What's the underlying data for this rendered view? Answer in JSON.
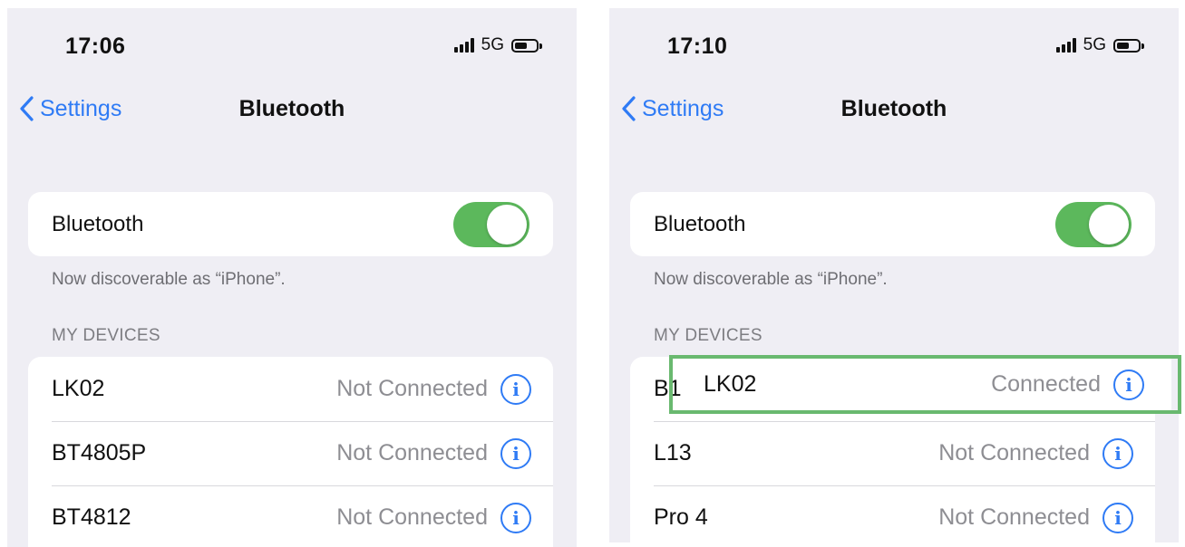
{
  "left": {
    "status": {
      "time": "17:06",
      "network": "5G"
    },
    "nav": {
      "back_label": "Settings",
      "title": "Bluetooth"
    },
    "toggle": {
      "label": "Bluetooth",
      "state": "on"
    },
    "footnote": "Now discoverable as “iPhone”.",
    "section_header": "MY DEVICES",
    "devices": [
      {
        "name": "LK02",
        "status": "Not Connected"
      },
      {
        "name": "BT4805P",
        "status": "Not Connected"
      },
      {
        "name": "BT4812",
        "status": "Not Connected"
      }
    ]
  },
  "right": {
    "status": {
      "time": "17:10",
      "network": "5G"
    },
    "nav": {
      "back_label": "Settings",
      "title": "Bluetooth"
    },
    "toggle": {
      "label": "Bluetooth",
      "state": "on"
    },
    "footnote": "Now discoverable as “iPhone”.",
    "section_header": "MY DEVICES",
    "underlying_partial_name": "B1",
    "highlighted_device": {
      "name": "LK02",
      "status": "Connected"
    },
    "devices": [
      {
        "name": "L13",
        "status": "Not Connected"
      },
      {
        "name": "Pro 4",
        "status": "Not Connected"
      }
    ]
  },
  "colors": {
    "accent": "#2f7bf5",
    "switch_on": "#5cb85c",
    "highlight": "#69b96f",
    "background": "#efeef4"
  },
  "icons": {
    "info": "info-circle-icon",
    "back": "chevron-left-icon"
  }
}
